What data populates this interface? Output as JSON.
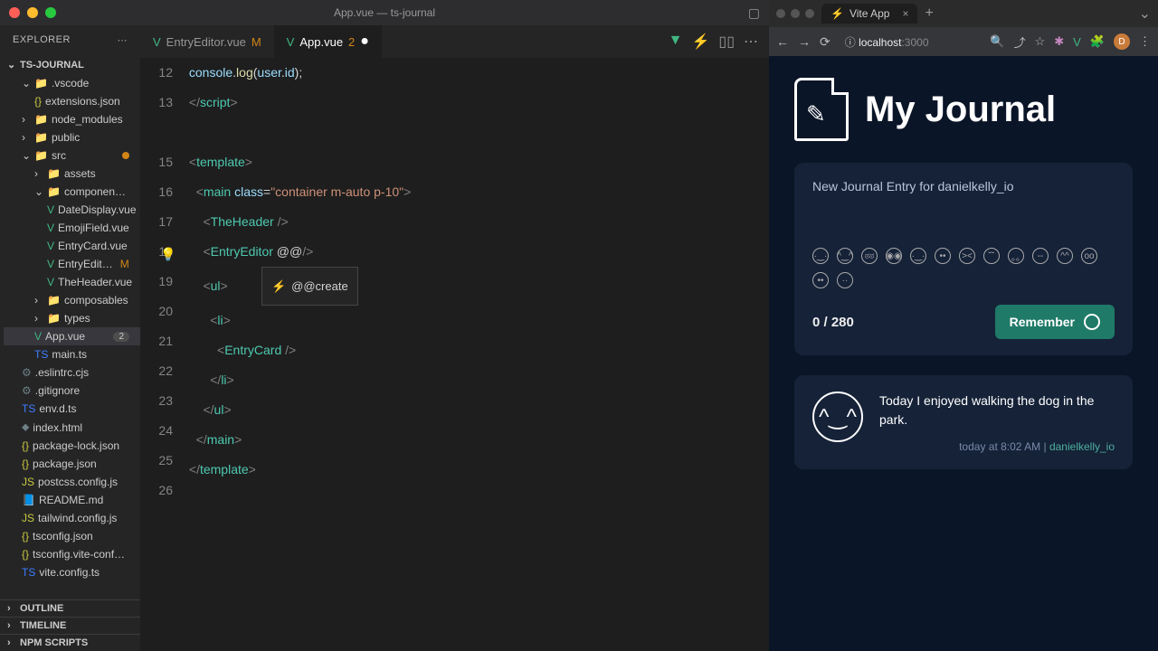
{
  "window": {
    "title": "App.vue — ts-journal"
  },
  "explorer": {
    "header": "EXPLORER",
    "project": "TS-JOURNAL",
    "outline": "OUTLINE",
    "timeline": "TIMELINE",
    "npm": "NPM SCRIPTS"
  },
  "tree": {
    "vscode": ".vscode",
    "extensions": "extensions.json",
    "node_modules": "node_modules",
    "public": "public",
    "src": "src",
    "assets": "assets",
    "components": "componen…",
    "date_display": "DateDisplay.vue",
    "emoji_field": "EmojiField.vue",
    "entry_card": "EntryCard.vue",
    "entry_edit": "EntryEdit…",
    "entry_edit_suffix": "M",
    "the_header": "TheHeader.vue",
    "composables": "composables",
    "types": "types",
    "app_vue": "App.vue",
    "app_vue_badge": "2",
    "main_ts": "main.ts",
    "eslintrc": ".eslintrc.cjs",
    "gitignore": ".gitignore",
    "env": "env.d.ts",
    "index": "index.html",
    "pkglock": "package-lock.json",
    "pkg": "package.json",
    "postcss": "postcss.config.js",
    "readme": "README.md",
    "tailwind": "tailwind.config.js",
    "tsconfig": "tsconfig.json",
    "tsconfig_vite": "tsconfig.vite-conf…",
    "viteconfig": "vite.config.ts"
  },
  "tabs": {
    "t1": "EntryEditor.vue",
    "t1_suffix": "M",
    "t2": "App.vue",
    "t2_suffix": "2"
  },
  "code": {
    "lines": [
      "12",
      "13",
      "",
      "15",
      "16",
      "17",
      "18",
      "19",
      "20",
      "21",
      "22",
      "23",
      "24",
      "25",
      "26"
    ]
  },
  "suggest": {
    "text": "@@create"
  },
  "browser": {
    "tab": "Vite App",
    "url_host": "localhost",
    "url_port": ":3000"
  },
  "app": {
    "title": "My Journal",
    "placeholder": "New Journal Entry for danielkelly_io",
    "counter": "0 / 280",
    "remember": "Remember",
    "entry_text": "Today I enjoyed walking the dog in the park.",
    "entry_time": "today at 8:02 AM",
    "entry_sep": "  |  ",
    "entry_user": "danielkelly_io"
  }
}
